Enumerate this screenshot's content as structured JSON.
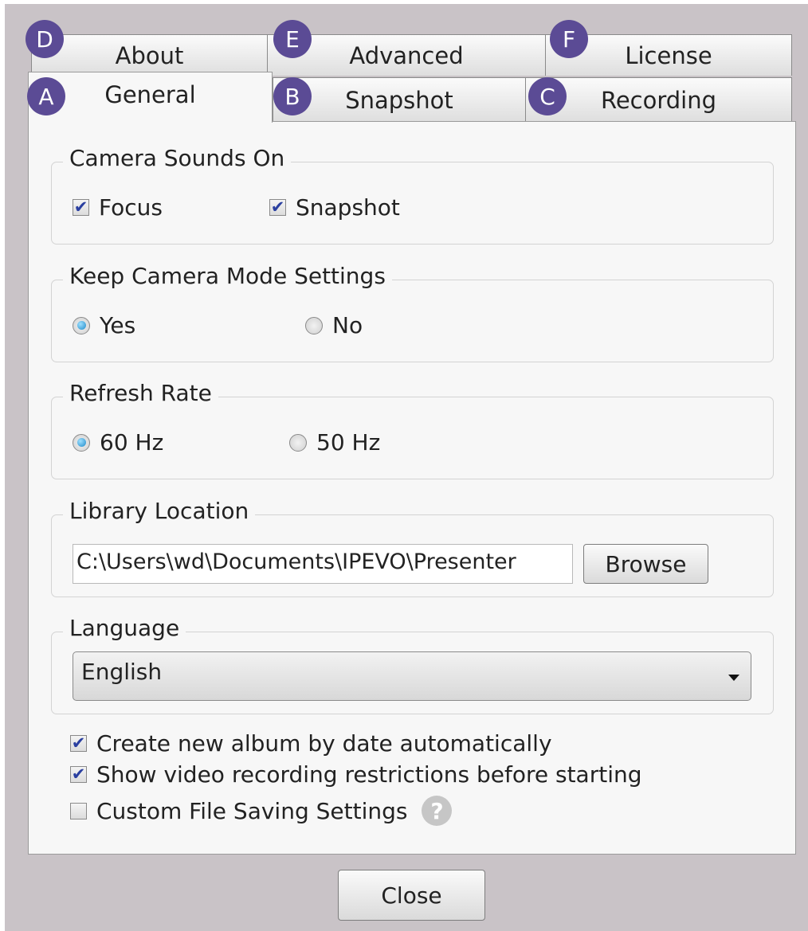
{
  "tabs": {
    "about": {
      "badge": "D",
      "label": "About"
    },
    "advanced": {
      "badge": "E",
      "label": "Advanced"
    },
    "license": {
      "badge": "F",
      "label": "License"
    },
    "general": {
      "badge": "A",
      "label": "General"
    },
    "snapshot": {
      "badge": "B",
      "label": "Snapshot"
    },
    "recording": {
      "badge": "C",
      "label": "Recording"
    }
  },
  "camera_sounds": {
    "title": "Camera Sounds On",
    "focus": {
      "label": "Focus",
      "checked": true
    },
    "snapshot": {
      "label": "Snapshot",
      "checked": true
    }
  },
  "keep_mode": {
    "title": "Keep Camera Mode Settings",
    "yes": {
      "label": "Yes",
      "selected": true
    },
    "no": {
      "label": "No",
      "selected": false
    }
  },
  "refresh_rate": {
    "title": "Refresh Rate",
    "hz60": {
      "label": "60 Hz",
      "selected": true
    },
    "hz50": {
      "label": "50 Hz",
      "selected": false
    }
  },
  "library": {
    "title": "Library Location",
    "path": "C:\\Users\\wd\\Documents\\IPEVO\\Presenter",
    "browse_label": "Browse"
  },
  "language": {
    "title": "Language",
    "selected": "English"
  },
  "options": {
    "album_by_date": {
      "label": "Create new album by date automatically",
      "checked": true
    },
    "show_restrictions": {
      "label": "Show video recording restrictions before starting",
      "checked": true
    },
    "custom_saving": {
      "label": "Custom File Saving Settings",
      "checked": false
    },
    "help_glyph": "?"
  },
  "close_label": "Close",
  "colors": {
    "badge": "#5b4b95",
    "background": "#c9c3c7",
    "panel": "#f7f7f7"
  },
  "check_glyph": "✔"
}
